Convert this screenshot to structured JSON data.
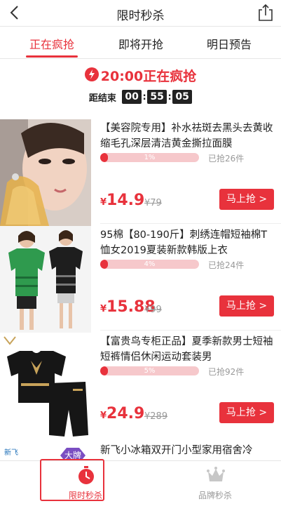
{
  "nav": {
    "title": "限时秒杀"
  },
  "tabs": [
    {
      "label": "正在疯抢",
      "active": true
    },
    {
      "label": "即将开抢",
      "active": false
    },
    {
      "label": "明日预告",
      "active": false
    }
  ],
  "flash": {
    "text": "20:00正在疯抢"
  },
  "countdown": {
    "label": "距结束",
    "hours": "00",
    "minutes": "55",
    "seconds": "05"
  },
  "products": [
    {
      "title": "【美容院专用】补水祛斑去黑头去黄收缩毛孔深层清洁黄金撕拉面膜",
      "progress_percent": 1,
      "progress_label": "1%",
      "sold": "已抢26件",
      "currency": "¥",
      "price": "14.9",
      "original_price": "¥79",
      "buy_label": "马上抢 >"
    },
    {
      "title": "95棉【80-190斤】刺绣连帽短袖棉T恤女2019夏装新款韩版上衣",
      "progress_percent": 4,
      "progress_label": "4%",
      "sold": "已抢24件",
      "currency": "¥",
      "price": "15.88",
      "original_price": "¥99",
      "buy_label": "马上抢 >"
    },
    {
      "title": "【富贵鸟专柜正品】夏季新款男士短袖短裤情侣休闲运动套装男",
      "progress_percent": 5,
      "progress_label": "5%",
      "sold": "已抢92件",
      "currency": "¥",
      "price": "24.9",
      "original_price": "¥289",
      "buy_label": "马上抢 >"
    }
  ],
  "partial_product": {
    "brand": "新飞",
    "badge": "大牌",
    "title": "新飞小冰箱双开门小型家用宿舍冷"
  },
  "tabbar": {
    "left": {
      "label": "限时秒杀",
      "icon": "stopwatch-icon",
      "active": true
    },
    "right": {
      "label": "品牌秒杀",
      "icon": "crown-icon",
      "active": false
    }
  },
  "colors": {
    "accent": "#e8323c",
    "bar_bg": "#f6c8cb",
    "muted": "#999999"
  }
}
